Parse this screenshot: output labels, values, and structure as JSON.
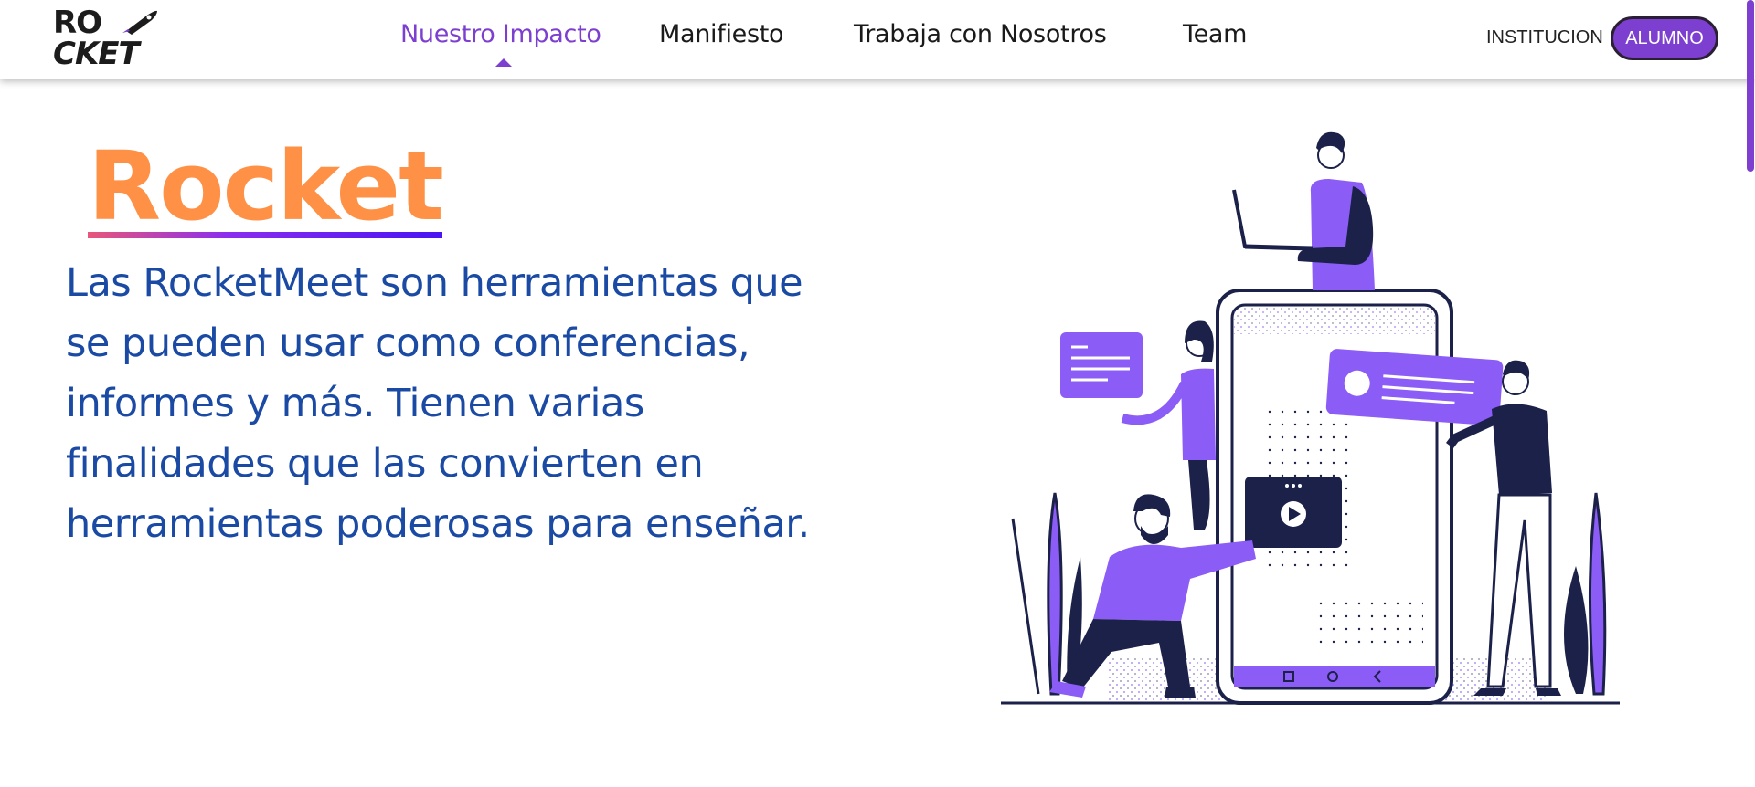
{
  "header": {
    "logo": {
      "line1": "RO",
      "line2": "CKET",
      "rocket_icon": "rocket-icon"
    },
    "nav": [
      {
        "label": "Nuestro Impacto",
        "active": true
      },
      {
        "label": "Manifiesto",
        "active": false
      },
      {
        "label": "Trabaja con Nosotros",
        "active": false
      },
      {
        "label": "Team",
        "active": false
      }
    ],
    "institucion_label": "INSTITUCION",
    "alumno_label": "ALUMNO"
  },
  "hero": {
    "title": "Rocket",
    "description": "Las RocketMeet son herramientas que se pueden usar como conferencias, informes y más. Tienen varias finalidades que las convierten en herramientas poderosas para enseñar."
  },
  "colors": {
    "accent": "#7c3fcf",
    "title_orange": "#ff9147",
    "text_blue": "#1a4aa3",
    "navy": "#1b2149",
    "illustration_purple": "#8b5cf6"
  }
}
